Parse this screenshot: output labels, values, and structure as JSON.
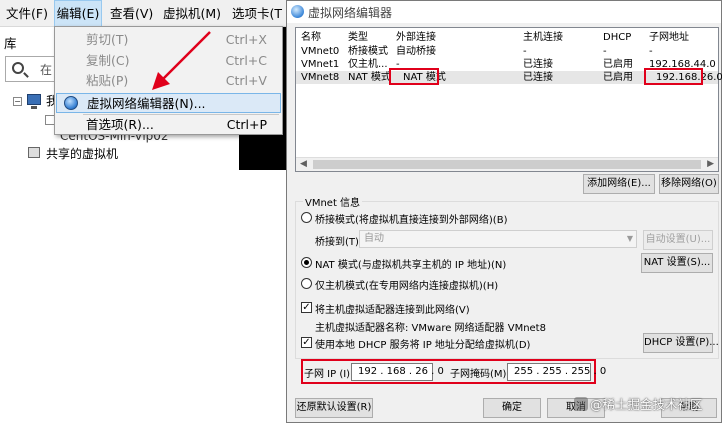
{
  "menubar": {
    "file": "文件(F)",
    "edit": "编辑(E)",
    "view": "查看(V)",
    "vm": "虚拟机(M)",
    "tabs": "选项卡(T"
  },
  "library": {
    "title": "库",
    "search_placeholder": "在",
    "tree_node_partial": "我",
    "vm_item": "CentOS-Min-Vip02",
    "shared": "共享的虚拟机"
  },
  "edit_menu": {
    "items": [
      {
        "label": "剪切(T)",
        "shortcut": "Ctrl+X",
        "enabled": false
      },
      {
        "label": "复制(C)",
        "shortcut": "Ctrl+C",
        "enabled": false
      },
      {
        "label": "粘贴(P)",
        "shortcut": "Ctrl+V",
        "enabled": false
      },
      {
        "label": "虚拟网络编辑器(N)...",
        "shortcut": "",
        "enabled": true,
        "highlighted": true,
        "icon": "globe-icon"
      },
      {
        "label": "首选项(R)...",
        "shortcut": "Ctrl+P",
        "enabled": true
      }
    ]
  },
  "dialog": {
    "title": "虚拟网络编辑器",
    "columns": [
      "名称",
      "类型",
      "外部连接",
      "主机连接",
      "DHCP",
      "子网地址"
    ],
    "rows": [
      [
        "VMnet0",
        "桥接模式",
        "自动桥接",
        "-",
        "-",
        "-"
      ],
      [
        "VMnet1",
        "仅主机...",
        "-",
        "已连接",
        "已启用",
        "192.168.44.0"
      ],
      [
        "VMnet8",
        "NAT 模式",
        "NAT 模式",
        "已连接",
        "已启用",
        "192.168.26.0"
      ]
    ],
    "add_network": "添加网络(E)...",
    "remove_network": "移除网络(O)",
    "vmnet_info": "VMnet 信息",
    "bridged_radio": "桥接模式(将虚拟机直接连接到外部网络)(B)",
    "bridged_to_label": "桥接到(T):",
    "bridged_to_value": "自动",
    "auto_settings": "自动设置(U)...",
    "nat_radio": "NAT 模式(与虚拟机共享主机的 IP 地址)(N)",
    "nat_settings": "NAT 设置(S)...",
    "hostonly_radio": "仅主机模式(在专用网络内连接虚拟机)(H)",
    "connect_adapter": "将主机虚拟适配器连接到此网络(V)",
    "adapter_name": "主机虚拟适配器名称: VMware 网络适配器 VMnet8",
    "use_dhcp": "使用本地 DHCP 服务将 IP 地址分配给虚拟机(D)",
    "dhcp_settings": "DHCP 设置(P)...",
    "subnet_ip_label": "子网 IP (I):",
    "subnet_ip": "192 . 168 . 26 . 0",
    "subnet_mask_label": "子网掩码(M):",
    "subnet_mask": "255 . 255 . 255 . 0",
    "restore_defaults": "还原默认设置(R)",
    "ok": "确定",
    "cancel": "取消",
    "help": "帮助"
  },
  "watermark": "@稀土掘金技术社区",
  "colors": {
    "highlight_red": "#e0001b",
    "menu_highlight": "#dbe9f7",
    "arrow_red": "#e0001b"
  }
}
